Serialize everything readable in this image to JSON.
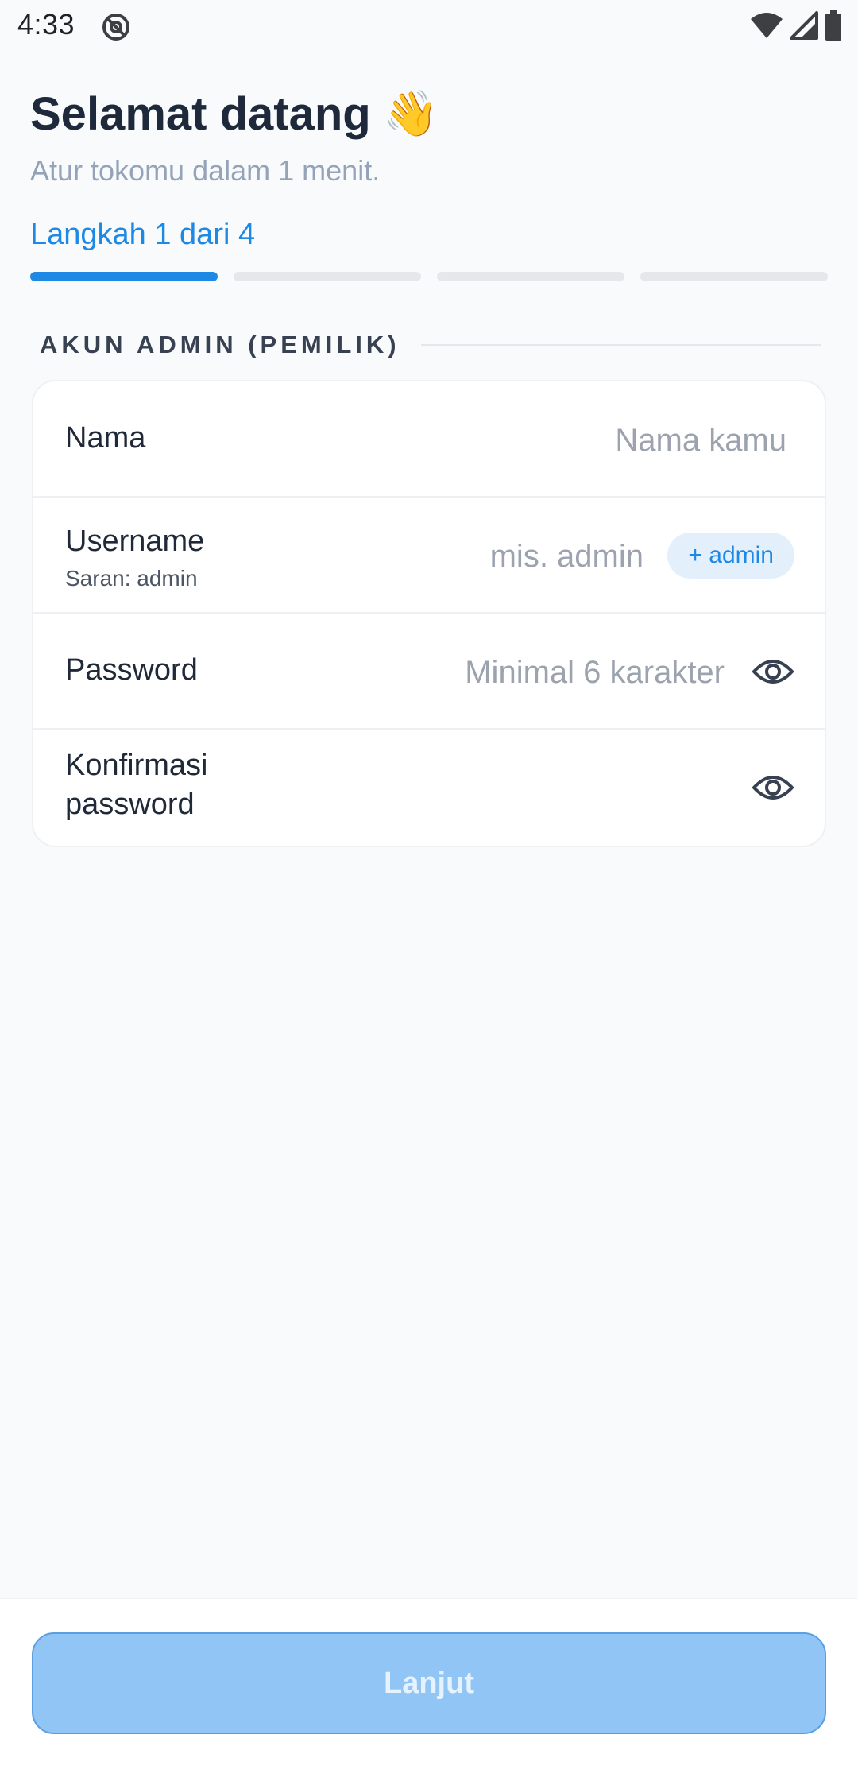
{
  "status_bar": {
    "time": "4:33",
    "icons": [
      "dnd-icon",
      "wifi-icon",
      "signal-icon",
      "battery-icon"
    ]
  },
  "header": {
    "title": "Selamat datang",
    "emoji": "👋",
    "subtitle": "Atur tokomu dalam 1 menit."
  },
  "progress": {
    "label": "Langkah 1 dari 4",
    "current_step": 1,
    "total_steps": 4
  },
  "section": {
    "title": "AKUN ADMIN (PEMILIK)"
  },
  "form": {
    "name": {
      "label": "Nama",
      "value": "",
      "placeholder": "Nama kamu"
    },
    "username": {
      "label": "Username",
      "hint": "Saran: admin",
      "value": "",
      "placeholder": "mis. admin",
      "chip": "+ admin"
    },
    "password": {
      "label": "Password",
      "value": "",
      "placeholder": "Minimal 6 karakter",
      "toggle_icon": "eye-icon"
    },
    "confirm": {
      "label_line1": "Konfirmasi",
      "label_line2": "password",
      "value": "",
      "placeholder": "",
      "toggle_icon": "eye-icon"
    }
  },
  "footer": {
    "next_label": "Lanjut",
    "next_enabled": false
  },
  "colors": {
    "accent": "#1e88e5",
    "background": "#f8fafc",
    "disabled_button": "#90c5f5"
  }
}
